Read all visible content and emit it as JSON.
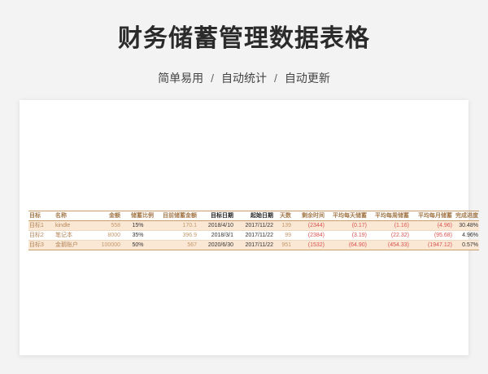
{
  "header": {
    "title": "财务储蓄管理数据表格",
    "tags": [
      "简单易用",
      "自动统计",
      "自动更新"
    ],
    "separator": "/"
  },
  "table": {
    "columns": [
      "目标",
      "名称",
      "金额",
      "储蓄比例",
      "目前储蓄金额",
      "目标日期",
      "起始日期",
      "天数",
      "剩余时间",
      "平均每天储蓄",
      "平均每周储蓄",
      "平均每月储蓄",
      "完成进度"
    ],
    "rows": [
      [
        "目标1",
        "kindle",
        "558",
        "15%",
        "170.1",
        "2018/4/10",
        "2017/11/22",
        "139",
        "(2344)",
        "(0.17)",
        "(1.16)",
        "(4.96)",
        "30.48%"
      ],
      [
        "目标2",
        "笔记本",
        "8000",
        "35%",
        "396.9",
        "2018/3/1",
        "2017/11/22",
        "99",
        "(2384)",
        "(3.19)",
        "(22.32)",
        "(95.68)",
        "4.96%"
      ],
      [
        "目标3",
        "金鹅账户",
        "100000",
        "50%",
        "567",
        "2020/6/30",
        "2017/11/22",
        "951",
        "(1532)",
        "(64.90)",
        "(454.33)",
        "(1947.12)",
        "0.57%"
      ]
    ]
  },
  "colors": {
    "accent_brown": "#b5865a",
    "negative_red": "#d9534f",
    "row_highlight": "#fbe8d4"
  }
}
